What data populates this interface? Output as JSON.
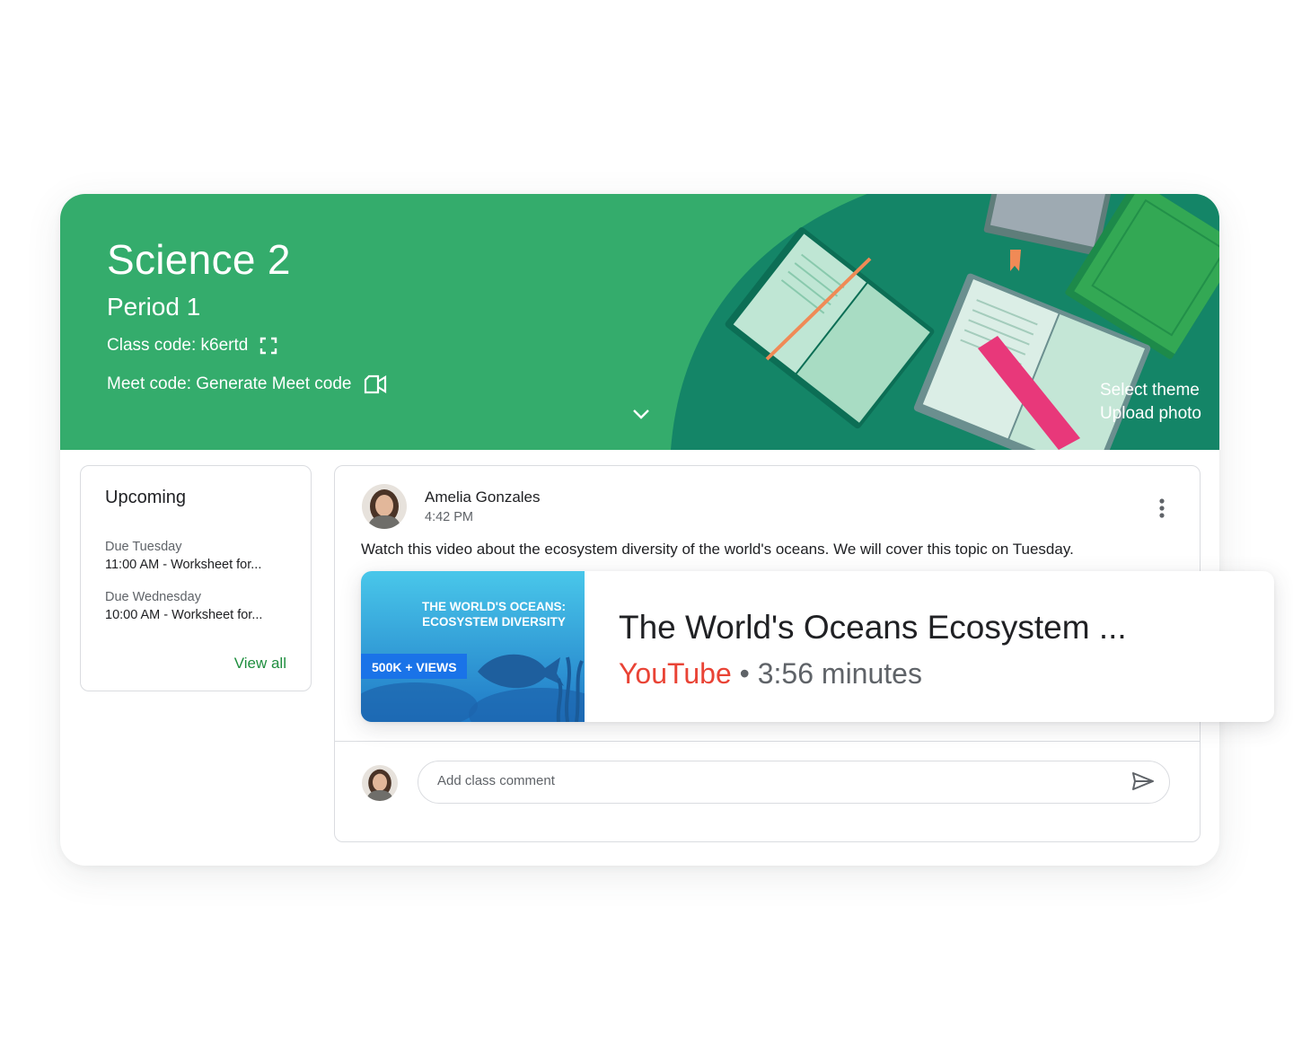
{
  "banner": {
    "class_title": "Science 2",
    "section": "Period 1",
    "class_code": "Class code: k6ertd",
    "meet_code": "Meet code: Generate Meet code",
    "select_theme": "Select theme",
    "upload_photo": "Upload photo",
    "color": "#34ac6c"
  },
  "upcoming": {
    "title": "Upcoming",
    "items": [
      {
        "due": "Due Tuesday",
        "text": "11:00 AM - Worksheet for..."
      },
      {
        "due": "Due Wednesday",
        "text": "10:00 AM - Worksheet for..."
      }
    ],
    "view_all": "View all"
  },
  "post": {
    "author": "Amelia Gonzales",
    "time": "4:42 PM",
    "text": "Watch this video about the ecosystem diversity of the world's oceans. We will cover this topic on Tuesday.",
    "comment_placeholder": "Add class comment"
  },
  "video": {
    "thumbnail_title_1": "THE WORLD'S OCEANS:",
    "thumbnail_title_2": "ECOSYSTEM DIVERSITY",
    "views_badge": "500K + VIEWS",
    "title": "The World's Oceans Ecosystem ...",
    "source": "YouTube",
    "separator": "•",
    "duration": "3:56 minutes",
    "source_color": "#e94335"
  },
  "icons": [
    "qr-code-icon",
    "video-camera-icon",
    "chevron-down-icon",
    "more-vert-icon",
    "send-icon"
  ]
}
